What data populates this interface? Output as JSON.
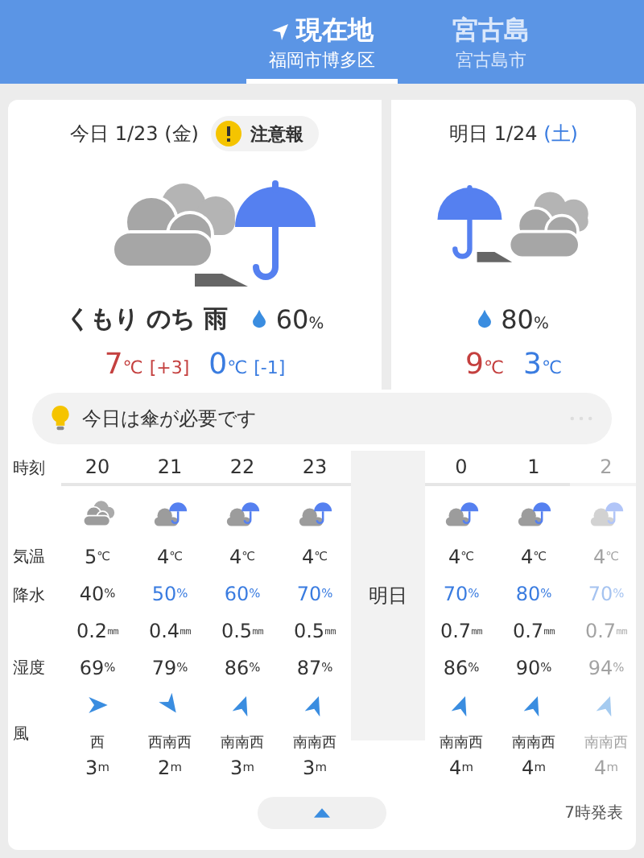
{
  "header": {
    "tabs": [
      {
        "title": "現在地",
        "subtitle": "福岡市博多区",
        "selected": true,
        "kind": "current"
      },
      {
        "title": "宮古島",
        "subtitle": "宮古島市",
        "selected": false,
        "kind": "place"
      }
    ]
  },
  "days": [
    {
      "label": "今日",
      "date": "1/23",
      "weekday": {
        "text": "(金)",
        "kind": "weekday"
      },
      "alert": "注意報",
      "kind": "cloudy_then_rain",
      "condition": "くもり のち 雨",
      "precip": "60%",
      "high": "7℃",
      "high_diff": "[+3]",
      "low": "0℃",
      "low_diff": "[-1]"
    },
    {
      "label": "明日",
      "date": "1/24",
      "weekday": {
        "text": "(土)",
        "kind": "saturday"
      },
      "kind": "rain_then_cloudy",
      "precip": "80%",
      "high": "9℃",
      "low": "3℃"
    }
  ],
  "tip": "今日は傘が必要です",
  "hourly": {
    "labels": [
      {
        "text": "時刻",
        "kind": "time"
      },
      {
        "text": "気温",
        "kind": "temp"
      },
      {
        "text": "降水",
        "kind": "precip"
      },
      {
        "text": "湿度",
        "kind": "humidity"
      },
      {
        "text": "風",
        "kind": "wind"
      }
    ],
    "today": [
      {
        "time": "20",
        "kind": "cloudy",
        "temp": "5℃",
        "precip": "40%",
        "rainy": false,
        "amount": "0.2㎜",
        "humidity": "69%",
        "wind": {
          "kind": "right",
          "direction": "西",
          "speed": "3m"
        },
        "faded": false
      },
      {
        "time": "21",
        "kind": "cloudy_rain",
        "temp": "4℃",
        "precip": "50%",
        "rainy": true,
        "amount": "0.4㎜",
        "humidity": "79%",
        "wind": {
          "kind": "down_right",
          "direction": "西南西",
          "speed": "2m"
        },
        "faded": false
      },
      {
        "time": "22",
        "kind": "cloudy_rain",
        "temp": "4℃",
        "precip": "60%",
        "rainy": true,
        "amount": "0.5㎜",
        "humidity": "86%",
        "wind": {
          "kind": "up",
          "direction": "南南西",
          "speed": "3m"
        },
        "faded": false
      },
      {
        "time": "23",
        "kind": "cloudy_rain",
        "temp": "4℃",
        "precip": "70%",
        "rainy": true,
        "amount": "0.5㎜",
        "humidity": "87%",
        "wind": {
          "kind": "up",
          "direction": "南南西",
          "speed": "3m"
        },
        "faded": false
      }
    ],
    "divider": "明日",
    "tomorrow": [
      {
        "time": "0",
        "kind": "cloudy_rain",
        "temp": "4℃",
        "precip": "70%",
        "rainy": true,
        "amount": "0.7㎜",
        "humidity": "86%",
        "wind": {
          "kind": "up",
          "direction": "南南西",
          "speed": "4m"
        },
        "faded": false
      },
      {
        "time": "1",
        "kind": "cloudy_rain",
        "temp": "4℃",
        "precip": "80%",
        "rainy": true,
        "amount": "0.7㎜",
        "humidity": "90%",
        "wind": {
          "kind": "up",
          "direction": "南南西",
          "speed": "4m"
        },
        "faded": false
      },
      {
        "time": "2",
        "kind": "cloudy_rain",
        "temp": "4℃",
        "precip": "70%",
        "rainy": true,
        "amount": "0.7㎜",
        "humidity": "94%",
        "wind": {
          "kind": "up",
          "direction": "南南西",
          "speed": "4m"
        },
        "faded": true
      }
    ]
  },
  "issued": "7時発表"
}
